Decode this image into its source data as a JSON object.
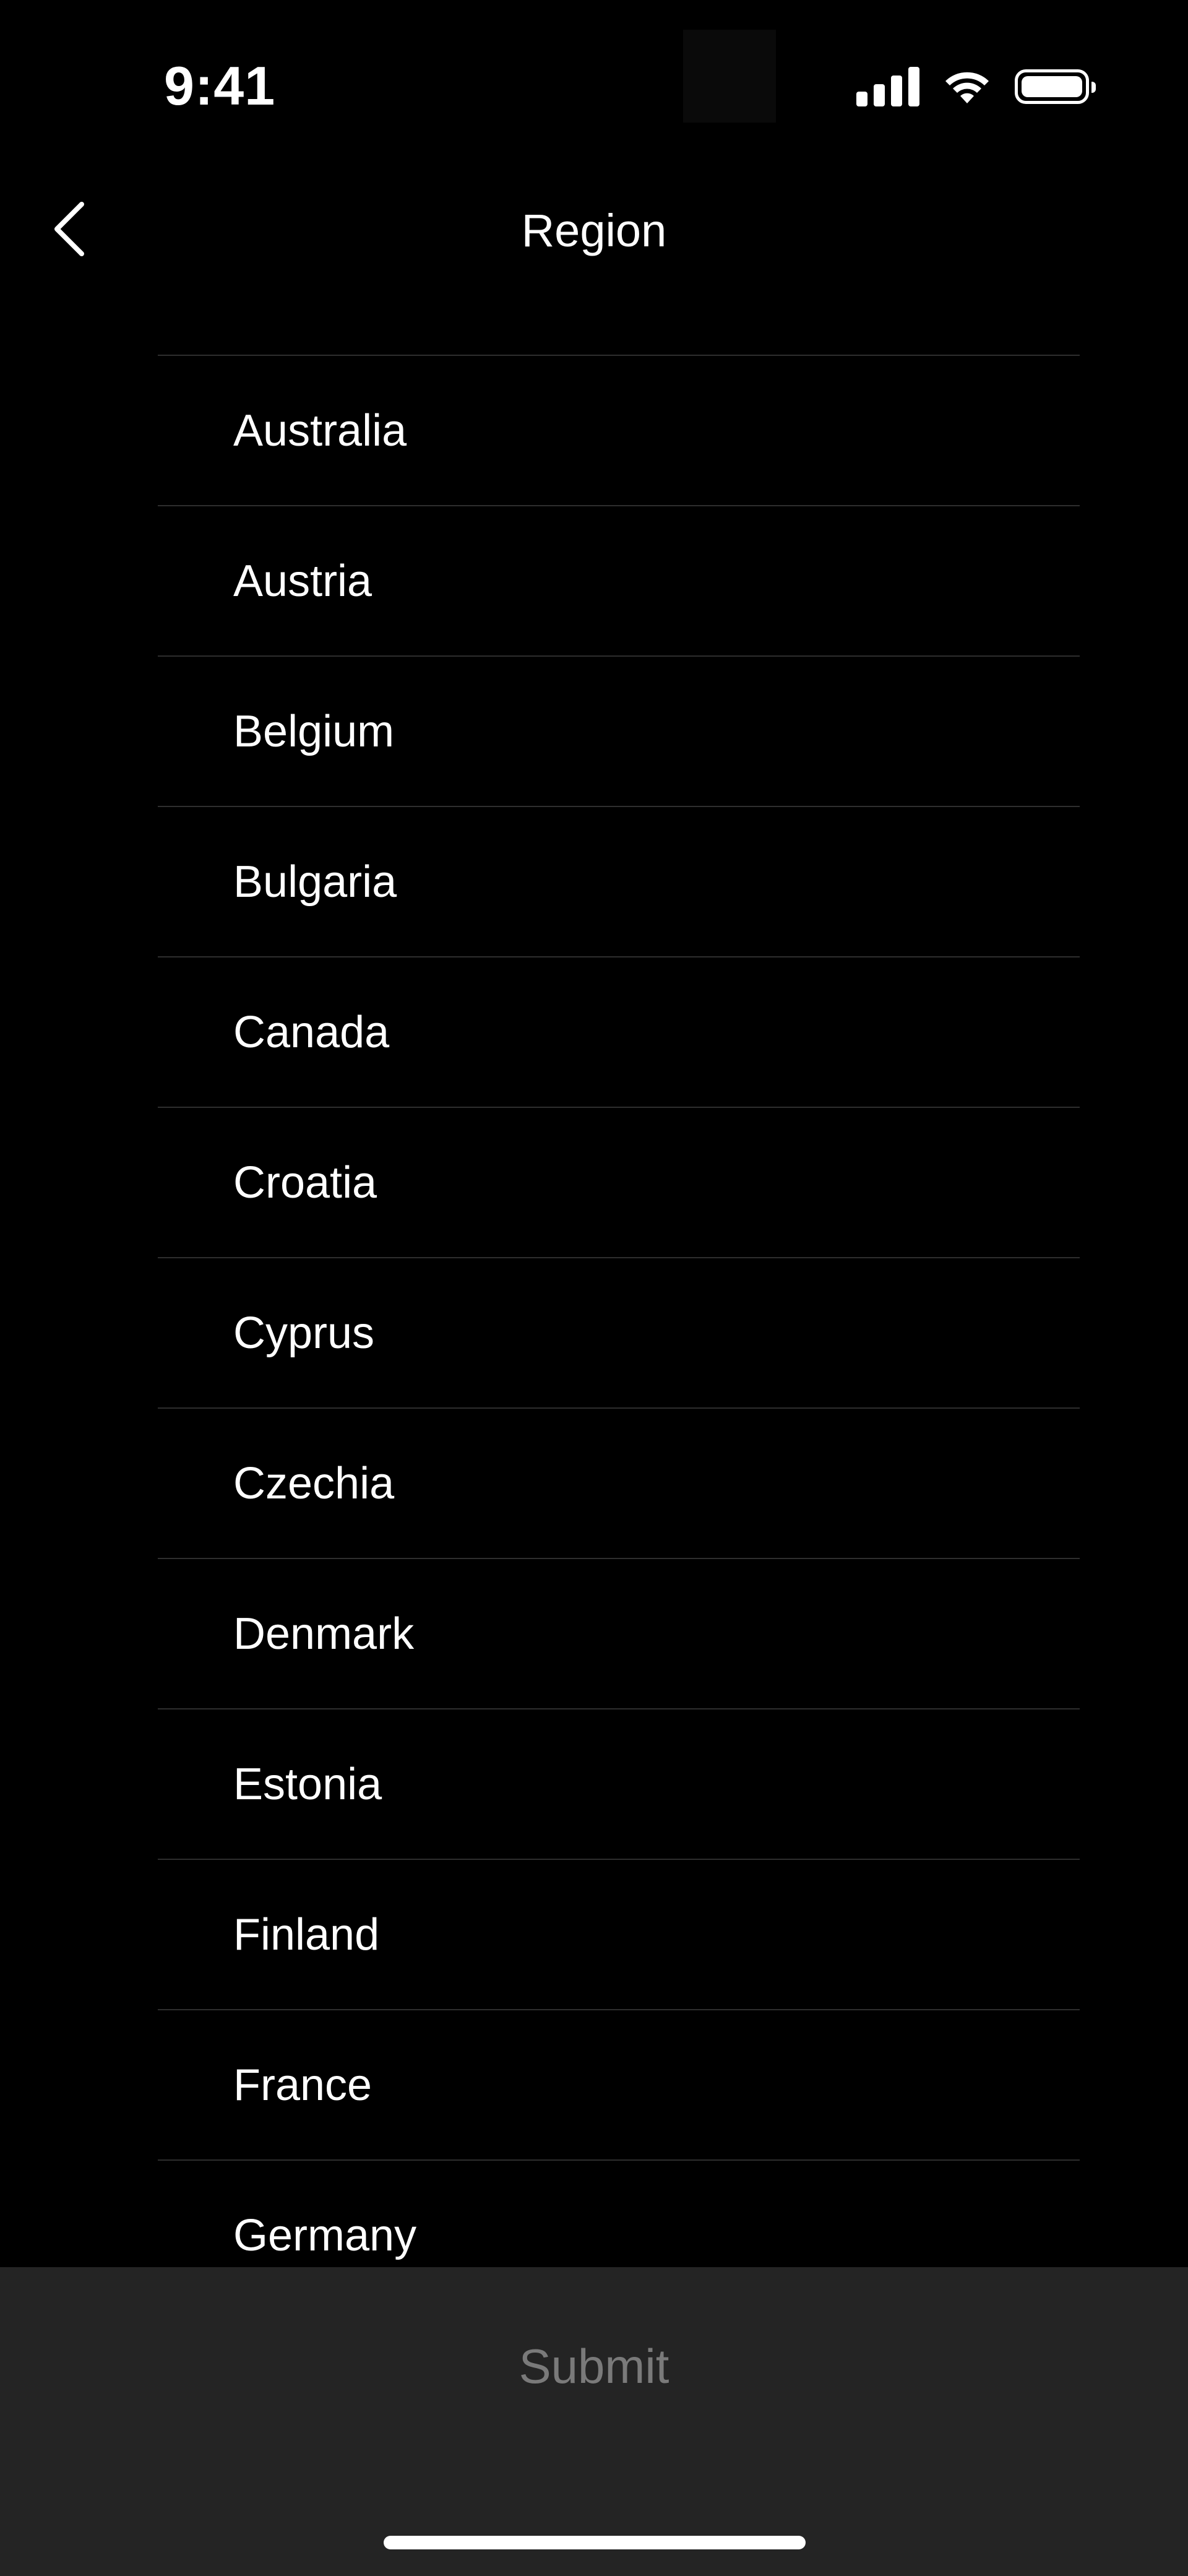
{
  "status_bar": {
    "time": "9:41"
  },
  "header": {
    "title": "Region"
  },
  "regions": [
    "Australia",
    "Austria",
    "Belgium",
    "Bulgaria",
    "Canada",
    "Croatia",
    "Cyprus",
    "Czechia",
    "Denmark",
    "Estonia",
    "Finland",
    "France",
    "Germany"
  ],
  "footer": {
    "submit_label": "Submit"
  },
  "colors": {
    "background": "#000000",
    "divider": "#2e2e2e",
    "bottom_bar": "#242424",
    "submit_text_disabled": "#7a7a7a",
    "text": "#ffffff"
  },
  "icons": {
    "back": "chevron-left-icon",
    "signal": "cellular-signal-icon",
    "wifi": "wifi-icon",
    "battery": "battery-icon"
  }
}
